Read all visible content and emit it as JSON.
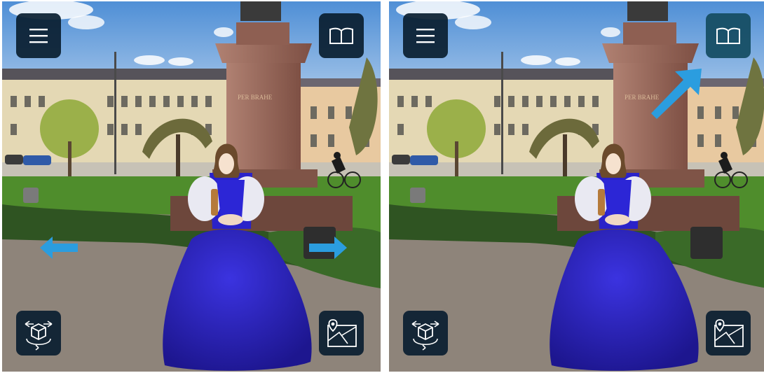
{
  "panels": [
    {
      "id": "left",
      "buttons": {
        "menu": {
          "icon": "hamburger-menu-icon"
        },
        "guide": {
          "icon": "open-book-icon"
        },
        "view": {
          "icon": "3d-rotate-cube-icon"
        },
        "map": {
          "icon": "map-location-icon"
        }
      },
      "hints": [
        "swipe-left-arrow",
        "swipe-right-arrow"
      ],
      "monument_inscription": "PER BRAHE"
    },
    {
      "id": "right",
      "buttons": {
        "menu": {
          "icon": "hamburger-menu-icon"
        },
        "guide": {
          "icon": "open-book-icon",
          "highlighted": true
        },
        "view": {
          "icon": "3d-rotate-cube-icon"
        },
        "map": {
          "icon": "map-location-icon"
        }
      },
      "hints": [
        "diagonal-arrow-to-guide"
      ],
      "monument_inscription": "PER BRAHE"
    }
  ],
  "colors": {
    "button_bg": "#0a1e30",
    "button_highlight_bg": "#164e64",
    "hint_arrow": "#2b9ddf",
    "dress": "#2a1fb8",
    "pedestal": "#9b6a5c",
    "sky": "#6aa3db",
    "grass": "#4f8d2c"
  }
}
